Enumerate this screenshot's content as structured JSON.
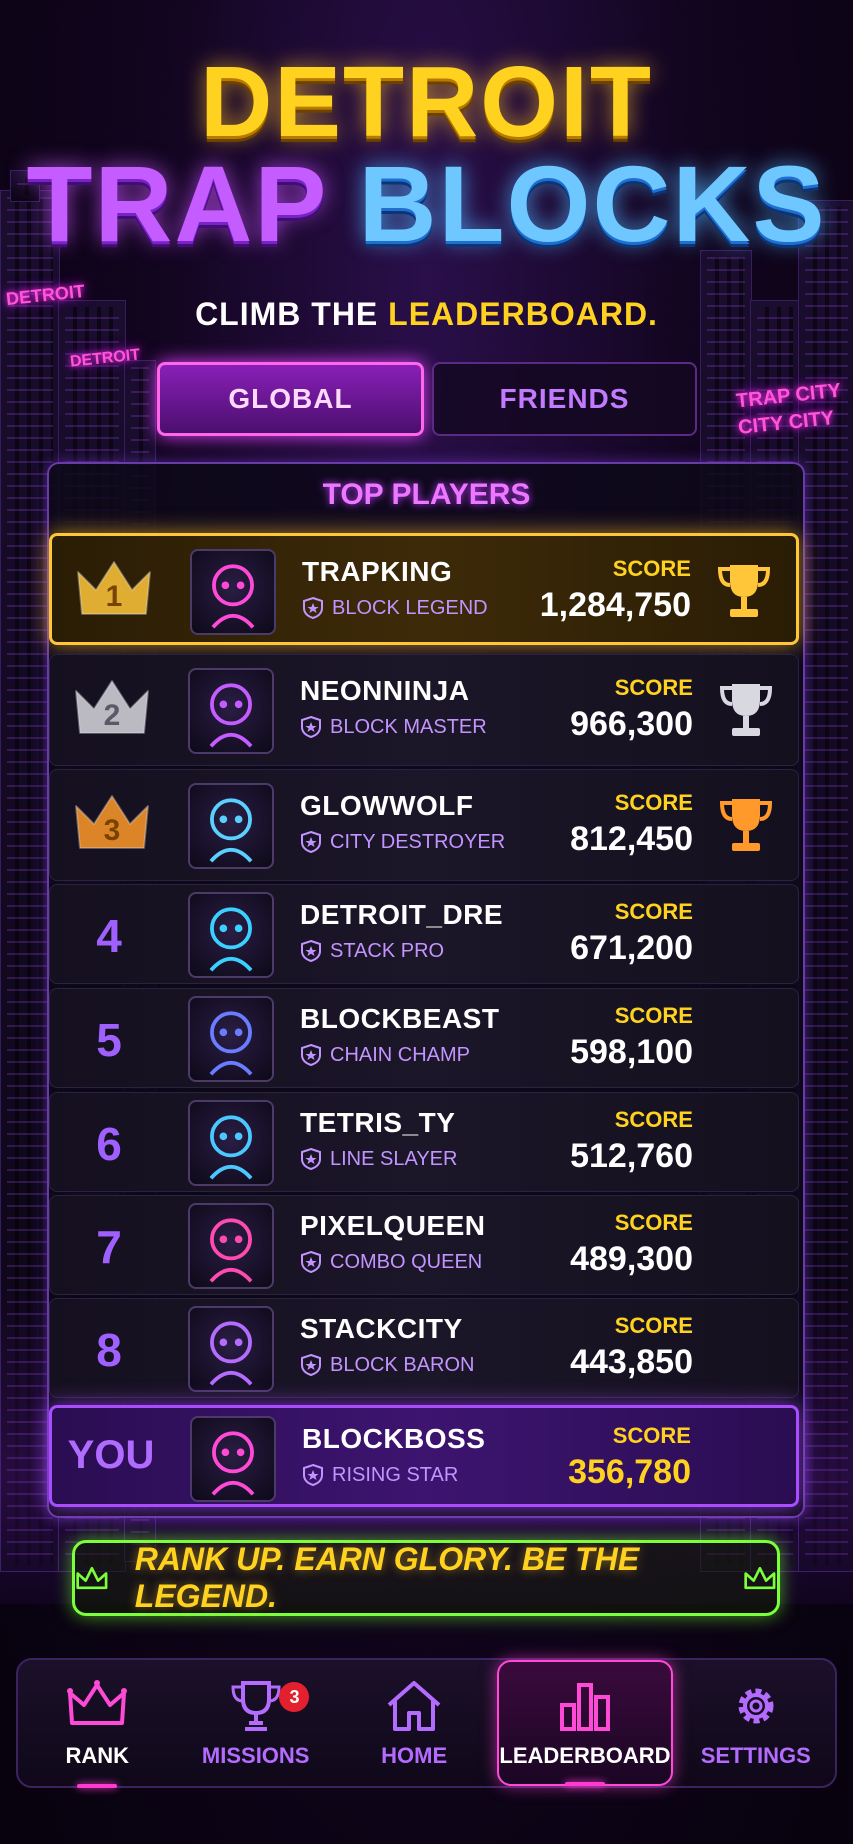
{
  "header": {
    "title_line1": "DETROIT",
    "title_trap": "TRAP",
    "title_blocks": "BLOCKS",
    "tagline_prefix": "CLIMB THE ",
    "tagline_highlight": "LEADERBOARD."
  },
  "signs": {
    "detroit_1": "DETROIT",
    "detroit_2": "DETROIT",
    "trap_city_1": "TRAP CITY",
    "trap_city_2": "CITY CITY"
  },
  "tabs": {
    "global": "GLOBAL",
    "friends": "FRIENDS",
    "active": "GLOBAL"
  },
  "panel_title": "TOP PLAYERS",
  "score_label": "SCORE",
  "players": [
    {
      "rank": "1",
      "name": "TRAPKING",
      "title": "BLOCK LEGEND",
      "score": "1,284,750",
      "trophy": "gold-trophy-icon",
      "avatar": "skull-crown-icon"
    },
    {
      "rank": "2",
      "name": "NEONNINJA",
      "title": "BLOCK MASTER",
      "score": "966,300",
      "trophy": "silver-trophy-icon",
      "avatar": "hooded-ninja-icon"
    },
    {
      "rank": "3",
      "name": "GLOWWOLF",
      "title": "CITY DESTROYER",
      "score": "812,450",
      "trophy": "bronze-trophy-icon",
      "avatar": "wolf-icon"
    },
    {
      "rank": "4",
      "name": "DETROIT_DRE",
      "title": "STACK PRO",
      "score": "671,200",
      "avatar": "gas-mask-icon"
    },
    {
      "rank": "5",
      "name": "BLOCKBEAST",
      "title": "CHAIN CHAMP",
      "score": "598,100",
      "avatar": "cat-beast-icon"
    },
    {
      "rank": "6",
      "name": "TETRIS_TY",
      "title": "LINE SLAYER",
      "score": "512,760",
      "avatar": "cap-skull-icon"
    },
    {
      "rank": "7",
      "name": "PIXELQUEEN",
      "title": "COMBO QUEEN",
      "score": "489,300",
      "avatar": "girl-cap-icon"
    },
    {
      "rank": "8",
      "name": "STACKCITY",
      "title": "BLOCK BARON",
      "score": "443,850",
      "avatar": "bear-glasses-icon"
    }
  ],
  "you": {
    "rank": "YOU",
    "name": "BLOCKBOSS",
    "title": "RISING STAR",
    "score": "356,780",
    "avatar": "pink-skull-icon"
  },
  "motto": "RANK UP. EARN GLORY. BE THE LEGEND.",
  "nav": {
    "rank": "RANK",
    "missions": "MISSIONS",
    "missions_badge": "3",
    "home": "HOME",
    "leaderboard": "LEADERBOARD",
    "settings": "SETTINGS"
  },
  "colors": {
    "gold": "#ffd21f",
    "purple": "#a060ff",
    "pink": "#ff3ad0",
    "green": "#7bff3a"
  }
}
